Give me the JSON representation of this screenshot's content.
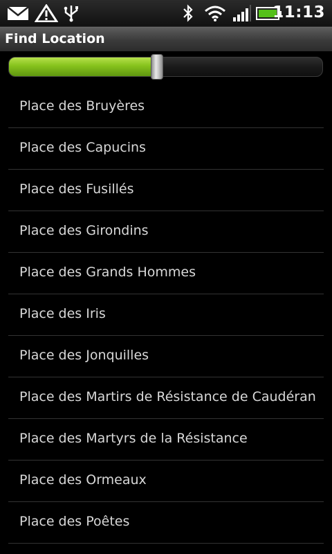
{
  "status_bar": {
    "time": "11:13",
    "icons": [
      "mail-icon",
      "warning-icon",
      "usb-icon",
      "bluetooth-icon",
      "wifi-icon",
      "signal-icon",
      "battery-icon"
    ],
    "battery_color": "#55c01a"
  },
  "title": "Find Location",
  "slider": {
    "value_fraction": 0.475,
    "fill_color": "#86c21c"
  },
  "list": {
    "items": [
      "Place des Bruyères",
      "Place des Capucins",
      "Place des Fusillés",
      "Place des Girondins",
      "Place des Grands Hommes",
      "Place des Iris",
      "Place des Jonquilles",
      "Place des Martirs de Résistance de Caudéran",
      "Place des Martyrs de la Résistance",
      "Place des Ormeaux",
      "Place des Poêtes"
    ]
  }
}
